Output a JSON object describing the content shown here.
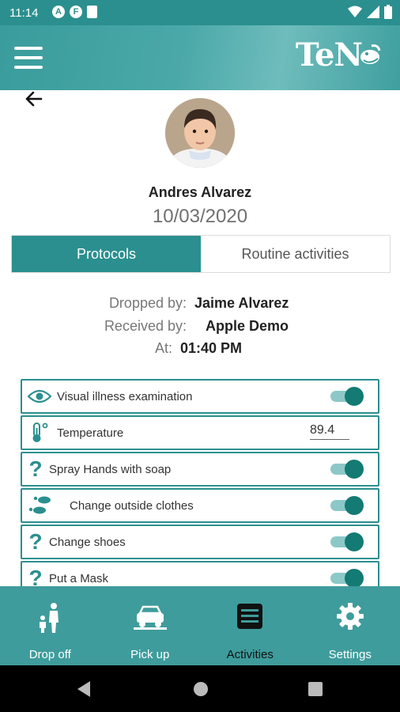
{
  "status_bar": {
    "time": "11:14",
    "icons": [
      "A",
      "F"
    ]
  },
  "child": {
    "name": "Andres Alvarez",
    "date": "10/03/2020"
  },
  "tabs": [
    {
      "label": "Protocols",
      "active": true
    },
    {
      "label": "Routine activities",
      "active": false
    }
  ],
  "handoff": {
    "dropped_by_label": "Dropped by:",
    "dropped_by": "Jaime Alvarez",
    "received_by_label": "Received by:",
    "received_by": "Apple Demo",
    "at_label": "At:",
    "at": "01:40 PM"
  },
  "protocols": [
    {
      "label": "Visual illness examination",
      "icon": "eye-icon",
      "toggle": true
    },
    {
      "label": "Temperature",
      "icon": "thermometer-icon",
      "value": "89.4"
    },
    {
      "label": "Spray Hands with soap",
      "icon": "question-icon",
      "toggle": true
    },
    {
      "label": "Change outside clothes",
      "icon": "footprints-icon",
      "toggle": true
    },
    {
      "label": "Change shoes",
      "icon": "question-icon",
      "toggle": true
    },
    {
      "label": "Put a Mask",
      "icon": "question-icon",
      "toggle": true
    }
  ],
  "bottom_nav": [
    {
      "label": "Drop off",
      "icon": "family-icon",
      "active": false
    },
    {
      "label": "Pick up",
      "icon": "car-icon",
      "active": false
    },
    {
      "label": "Activities",
      "icon": "activities-icon",
      "active": true
    },
    {
      "label": "Settings",
      "icon": "gear-icon",
      "active": false
    }
  ],
  "colors": {
    "primary": "#2b8f8f",
    "toggle_on": "#137a74",
    "toggle_track": "#8cc8c8"
  },
  "logo_text": "TeN"
}
